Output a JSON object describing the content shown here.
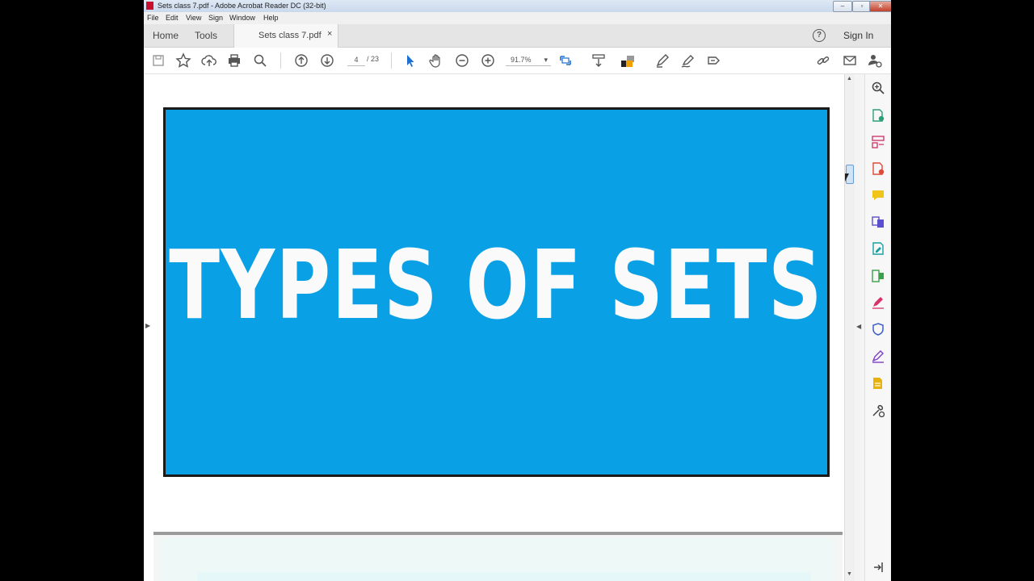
{
  "window": {
    "title": "Sets class 7.pdf - Adobe Acrobat Reader DC (32-bit)"
  },
  "menu": {
    "items": [
      "File",
      "Edit",
      "View",
      "Sign",
      "Window",
      "Help"
    ]
  },
  "tabs": {
    "home": "Home",
    "tools": "Tools",
    "document": "Sets class 7.pdf",
    "close": "×"
  },
  "header": {
    "help": "?",
    "sign_in": "Sign In"
  },
  "toolbar": {
    "page_current": "4",
    "page_total": "/ 23",
    "zoom": "91.7%",
    "icons": [
      "save-icon",
      "bookmark-star-icon",
      "upload-cloud-icon",
      "print-icon",
      "search-icon",
      "previous-page-icon",
      "next-page-icon",
      "select-cursor-icon",
      "hand-icon",
      "zoom-out-icon",
      "zoom-in-icon",
      "page-fit-icon",
      "scroll-mode-icon",
      "comment-icon",
      "highlight-pen-icon",
      "draw-icon",
      "fill-sign-icon",
      "share-link-icon",
      "email-icon",
      "add-user-icon"
    ]
  },
  "document": {
    "slide_text": "TYPES OF SETS",
    "slide_color": "#0aa0e5"
  },
  "right_panel": {
    "icons": [
      "zoom-tool-icon",
      "export-pdf-icon",
      "organize-pages-icon",
      "create-pdf-icon",
      "comment-tool-icon",
      "combine-files-icon",
      "edit-pdf-icon",
      "compress-icon",
      "fill-sign-tool-icon",
      "protect-icon",
      "send-for-signature-icon",
      "scan-icon",
      "more-tools-icon",
      "collapse-panel-icon"
    ]
  }
}
